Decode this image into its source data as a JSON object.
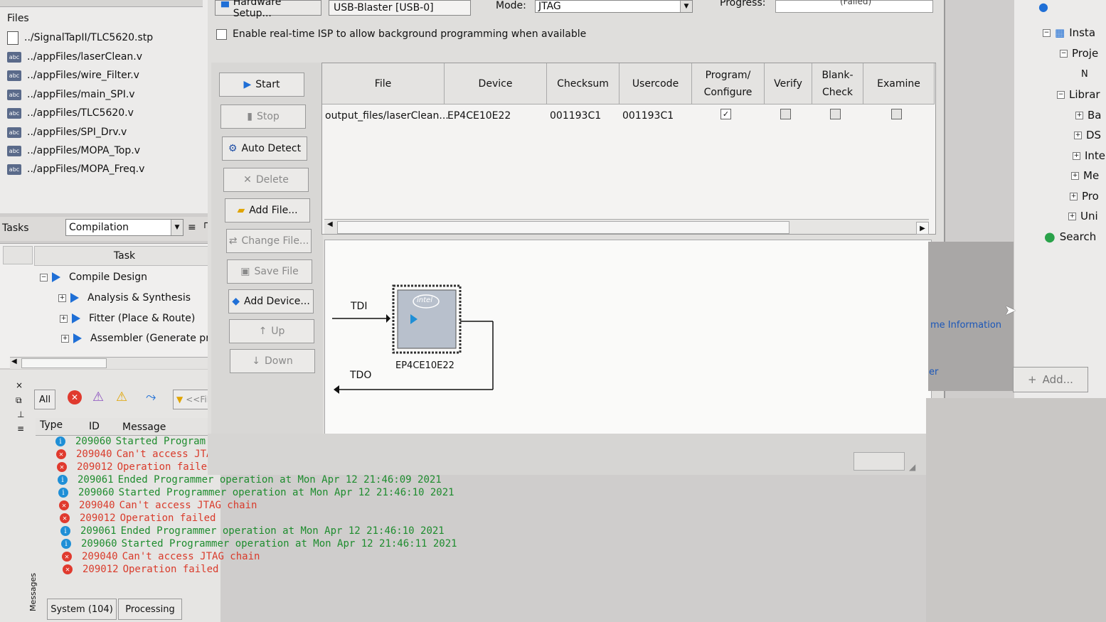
{
  "files": {
    "title": "Files",
    "items": [
      {
        "name": "../SignalTapII/TLC5620.stp",
        "icon": "document-icon"
      },
      {
        "name": "../appFiles/laserClean.v",
        "icon": "verilog-abc-icon"
      },
      {
        "name": "../appFiles/wire_Filter.v",
        "icon": "verilog-abc-icon"
      },
      {
        "name": "../appFiles/main_SPI.v",
        "icon": "verilog-abc-icon"
      },
      {
        "name": "../appFiles/TLC5620.v",
        "icon": "verilog-abc-icon"
      },
      {
        "name": "../appFiles/SPI_Drv.v",
        "icon": "verilog-abc-icon"
      },
      {
        "name": "../appFiles/MOPA_Top.v",
        "icon": "verilog-abc-icon"
      },
      {
        "name": "../appFiles/MOPA_Freq.v",
        "icon": "verilog-abc-icon"
      }
    ]
  },
  "tasks": {
    "label": "Tasks",
    "selected": "Compilation",
    "header": "Task",
    "items": [
      {
        "label": "Compile Design"
      },
      {
        "label": "Analysis & Synthesis"
      },
      {
        "label": "Fitter (Place & Route)"
      },
      {
        "label": "Assembler (Generate progra"
      }
    ]
  },
  "programmer": {
    "hardware_setup_label": "Hardware Setup...",
    "cable": "USB-Blaster [USB-0]",
    "mode_label": "Mode:",
    "mode_value": "JTAG",
    "progress_label": "Progress:",
    "progress_text": "(Failed)",
    "isp_label": "Enable real-time ISP to allow background programming when available",
    "buttons": {
      "start": "Start",
      "stop": "Stop",
      "auto_detect": "Auto Detect",
      "delete": "Delete",
      "add_file": "Add File...",
      "change_file": "Change File...",
      "save_file": "Save File",
      "add_device": "Add Device...",
      "up": "Up",
      "down": "Down"
    },
    "table": {
      "headers": {
        "file": "File",
        "device": "Device",
        "checksum": "Checksum",
        "usercode": "Usercode",
        "program_configure": "Program/ Configure",
        "verify": "Verify",
        "blank_check": "Blank- Check",
        "examine": "Examine"
      },
      "rows": [
        {
          "file": "output_files/laserClean...",
          "device": "EP4CE10E22",
          "checksum": "001193C1",
          "usercode": "001193C1",
          "program": true,
          "verify": false,
          "blank_check": false,
          "examine": false
        }
      ]
    },
    "chain": {
      "tdi": "TDI",
      "tdo": "TDO",
      "chip_name": "EP4CE10E22",
      "chip_logo": "intel"
    }
  },
  "messages": {
    "filters": {
      "all": "All",
      "filter_placeholder": "<<Filt"
    },
    "headers": {
      "type": "Type",
      "id": "ID",
      "message": "Message"
    },
    "lines": [
      {
        "type": "info",
        "id": "209060",
        "text": "Started Program"
      },
      {
        "type": "error",
        "id": "209040",
        "text": "Can't access JTAG chain"
      },
      {
        "type": "error",
        "id": "209012",
        "text": "Operation failed"
      },
      {
        "type": "info",
        "id": "209061",
        "text": "Ended Programmer operation at Mon Apr 12 21:46:09 2021"
      },
      {
        "type": "info",
        "id": "209060",
        "text": "Started Programmer operation at Mon Apr 12 21:46:10 2021"
      },
      {
        "type": "error",
        "id": "209040",
        "text": "Can't access JTAG chain"
      },
      {
        "type": "error",
        "id": "209012",
        "text": "Operation failed"
      },
      {
        "type": "info",
        "id": "209061",
        "text": "Ended Programmer operation at Mon Apr 12 21:46:10 2021"
      },
      {
        "type": "info",
        "id": "209060",
        "text": "Started Programmer operation at Mon Apr 12 21:46:11 2021"
      },
      {
        "type": "error",
        "id": "209040",
        "text": "Can't access JTAG chain"
      },
      {
        "type": "error",
        "id": "209012",
        "text": "Operation failed"
      }
    ],
    "side_label": "Messages",
    "tabs": [
      "System (104)",
      "Processing"
    ]
  },
  "right_panel": {
    "items": [
      "Insta",
      "Proje",
      "N",
      "Librar",
      "Ba",
      "DS",
      "Inte",
      "Me",
      "Pro",
      "Uni",
      "Search"
    ],
    "link": "me Information",
    "link2": "er",
    "add_button": "Add..."
  },
  "colors": {
    "info": "#1f8fd6",
    "error": "#e03a2e",
    "info_text": "#1e8c2e",
    "error_text": "#d93b2b",
    "link": "#1a56b8"
  }
}
